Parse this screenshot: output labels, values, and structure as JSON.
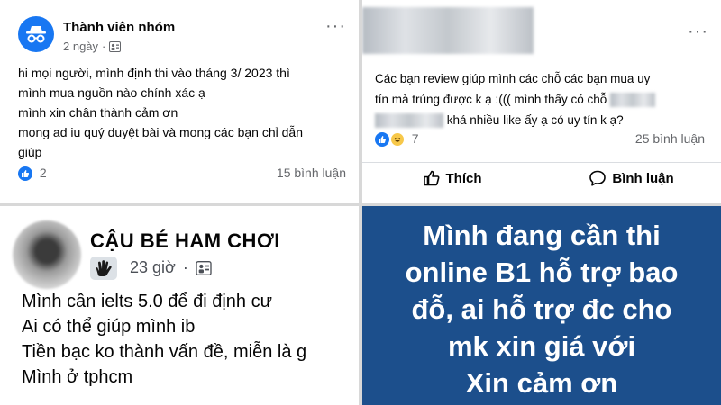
{
  "post1": {
    "author": "Thành viên nhóm",
    "time": "2 ngày",
    "dot": "·",
    "more": "···",
    "lines": [
      "hi mọi người, mình định thi vào tháng 3/ 2023 thì",
      "mình mua nguồn nào chính xác ạ",
      "mình xin chân thành cảm ơn",
      "mong ad iu quý duyệt bài và mong các bạn chỉ dẫn",
      "giúp"
    ],
    "reaction_count": "2",
    "comments": "15 bình luận"
  },
  "post2": {
    "more": "···",
    "line1": "Các bạn review giúp mình các chỗ các bạn mua uy",
    "line2": "tín mà trúng được k ạ :((( mình thấy có chỗ",
    "line3": "khá nhiều like ấy ạ có uy tín k ạ?",
    "reaction_count": "7",
    "comments": "25 bình luận",
    "like_label": "Thích",
    "comment_label": "Bình luận"
  },
  "post3": {
    "author": "CẬU BÉ HAM CHƠI",
    "time": "23 giờ",
    "dot": "·",
    "lines": [
      "Mình cần ielts 5.0 để đi định cư",
      "Ai có thể giúp mình ib",
      "Tiền bạc ko thành vấn đề, miễn là g",
      "Mình ở tphcm"
    ]
  },
  "post4": {
    "lines": [
      "Mình đang cần thi",
      "online B1 hỗ trợ bao",
      "đỗ, ai hỗ trợ đc cho",
      "mk xin giá với",
      "Xin cảm ơn"
    ]
  },
  "colors": {
    "facebook_blue": "#1877f2",
    "banner_bg": "#1c4f8c",
    "muted_text": "#65676b"
  }
}
